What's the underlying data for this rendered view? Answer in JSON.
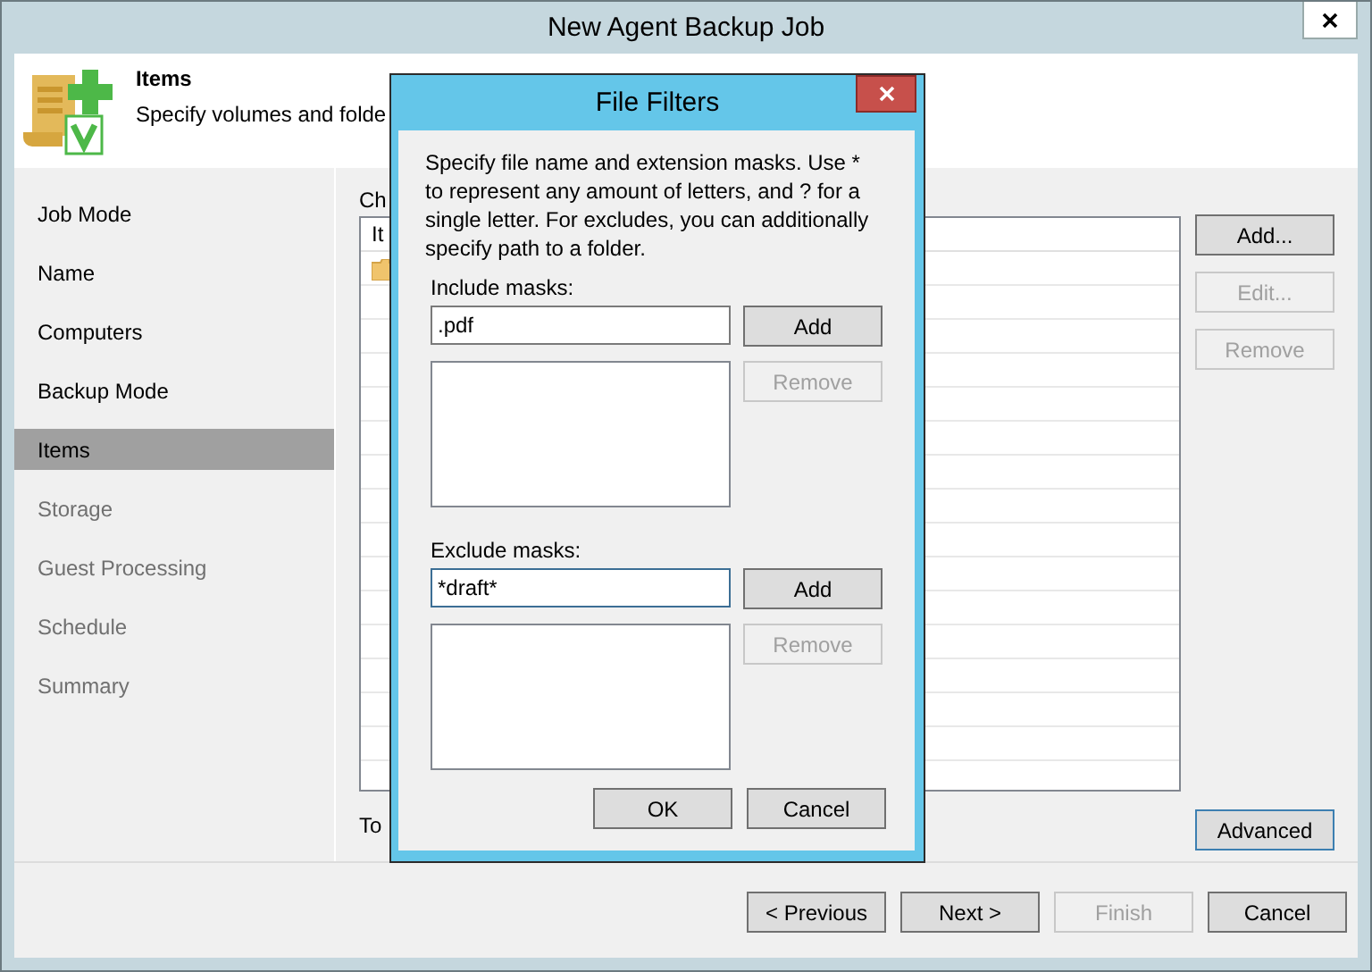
{
  "window": {
    "title": "New Agent Backup Job"
  },
  "header": {
    "title": "Items",
    "description": "Specify volumes and folde"
  },
  "nav": [
    {
      "label": "Job Mode",
      "selected": false,
      "disabled": false
    },
    {
      "label": "Name",
      "selected": false,
      "disabled": false
    },
    {
      "label": "Computers",
      "selected": false,
      "disabled": false
    },
    {
      "label": "Backup Mode",
      "selected": false,
      "disabled": false
    },
    {
      "label": "Items",
      "selected": true,
      "disabled": false
    },
    {
      "label": "Storage",
      "selected": false,
      "disabled": true
    },
    {
      "label": "Guest Processing",
      "selected": false,
      "disabled": true
    },
    {
      "label": "Schedule",
      "selected": false,
      "disabled": true
    },
    {
      "label": "Summary",
      "selected": false,
      "disabled": true
    }
  ],
  "content": {
    "label": "Ch",
    "table": {
      "column_1": "It"
    },
    "side_buttons": [
      {
        "label": "Add...",
        "disabled": false
      },
      {
        "label": "Edit...",
        "disabled": true
      },
      {
        "label": "Remove",
        "disabled": true
      }
    ],
    "footer_label": "To",
    "advanced_button": {
      "label": "Advanced",
      "focused": true
    }
  },
  "footer_buttons": [
    {
      "label": "< Previous",
      "disabled": false
    },
    {
      "label": "Next >",
      "disabled": false
    },
    {
      "label": "Finish",
      "disabled": true
    },
    {
      "label": "Cancel",
      "disabled": false
    }
  ],
  "dialog": {
    "title": "File Filters",
    "description": "Specify file name and extension masks. Use * to represent any amount of letters, and ? for a single letter. For excludes, you can additionally specify path to a folder.",
    "sections": [
      {
        "label": "Include masks:",
        "value": ".pdf",
        "focused": false,
        "add": {
          "label": "Add",
          "disabled": false
        },
        "remove": {
          "label": "Remove",
          "disabled": true
        }
      },
      {
        "label": "Exclude masks:",
        "value": "*draft*",
        "focused": true,
        "add": {
          "label": "Add",
          "disabled": false
        },
        "remove": {
          "label": "Remove",
          "disabled": true
        }
      }
    ],
    "buttons": [
      {
        "label": "OK",
        "disabled": false
      },
      {
        "label": "Cancel",
        "disabled": false
      }
    ]
  }
}
